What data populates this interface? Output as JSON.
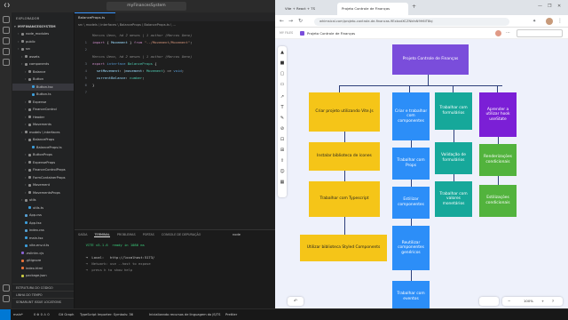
{
  "vscode": {
    "title": "myFinancesSystem",
    "menus": [
      "File",
      "Edit",
      "Selection",
      "View",
      "Go",
      "Run",
      "..."
    ],
    "explorer": {
      "header": "EXPLORADOR",
      "project": "MYFINANCESSYSTEM",
      "items": [
        {
          "label": "node_modules",
          "indent": 1,
          "kind": "folder",
          "color": "#8a8a8a"
        },
        {
          "label": "public",
          "indent": 1,
          "kind": "folder",
          "color": "#8a8a8a"
        },
        {
          "label": "src",
          "indent": 1,
          "kind": "folder",
          "color": "#8a8a8a"
        },
        {
          "label": "assets",
          "indent": 2,
          "kind": "folder",
          "color": "#8a8a8a"
        },
        {
          "label": "components",
          "indent": 2,
          "kind": "folder",
          "color": "#8a8a8a"
        },
        {
          "label": "Balance",
          "indent": 3,
          "kind": "folder",
          "color": "#8a8a8a"
        },
        {
          "label": "Button",
          "indent": 3,
          "kind": "folder",
          "color": "#8a8a8a"
        },
        {
          "label": "Button.tsx",
          "indent": 4,
          "kind": "file",
          "color": "#3c9dda",
          "selected": true
        },
        {
          "label": "Button.ts",
          "indent": 4,
          "kind": "file",
          "color": "#3c9dda"
        },
        {
          "label": "Expense",
          "indent": 3,
          "kind": "folder",
          "color": "#8a8a8a"
        },
        {
          "label": "FinanceControl",
          "indent": 3,
          "kind": "folder",
          "color": "#8a8a8a"
        },
        {
          "label": "Header",
          "indent": 3,
          "kind": "folder",
          "color": "#8a8a8a"
        },
        {
          "label": "Movements",
          "indent": 3,
          "kind": "folder",
          "color": "#8a8a8a"
        },
        {
          "label": "models \\ interfaces",
          "indent": 2,
          "kind": "folder",
          "color": "#8a8a8a"
        },
        {
          "label": "BalanceProps",
          "indent": 3,
          "kind": "folder",
          "color": "#8a8a8a"
        },
        {
          "label": "BalanceProps.ts",
          "indent": 4,
          "kind": "file",
          "color": "#3c9dda"
        },
        {
          "label": "ButtonProps",
          "indent": 3,
          "kind": "folder",
          "color": "#8a8a8a"
        },
        {
          "label": "ExpenseProps",
          "indent": 3,
          "kind": "folder",
          "color": "#8a8a8a"
        },
        {
          "label": "FinanceControlProps",
          "indent": 3,
          "kind": "folder",
          "color": "#8a8a8a"
        },
        {
          "label": "FormContainerProps",
          "indent": 3,
          "kind": "folder",
          "color": "#8a8a8a"
        },
        {
          "label": "Movement",
          "indent": 3,
          "kind": "folder",
          "color": "#8a8a8a"
        },
        {
          "label": "MovementsProps",
          "indent": 3,
          "kind": "folder",
          "color": "#8a8a8a"
        },
        {
          "label": "utils",
          "indent": 2,
          "kind": "folder",
          "color": "#8a8a8a"
        },
        {
          "label": "utils.ts",
          "indent": 3,
          "kind": "file",
          "color": "#3c9dda"
        },
        {
          "label": "App.css",
          "indent": 2,
          "kind": "file",
          "color": "#56a0d3"
        },
        {
          "label": "App.tsx",
          "indent": 2,
          "kind": "file",
          "color": "#3c9dda"
        },
        {
          "label": "index.css",
          "indent": 2,
          "kind": "file",
          "color": "#56a0d3"
        },
        {
          "label": "main.tsx",
          "indent": 2,
          "kind": "file",
          "color": "#3c9dda"
        },
        {
          "label": "vite-env.d.ts",
          "indent": 2,
          "kind": "file",
          "color": "#3c9dda"
        },
        {
          "label": ".eslintrc.cjs",
          "indent": 1,
          "kind": "file",
          "color": "#8a63d2"
        },
        {
          "label": ".gitignore",
          "indent": 1,
          "kind": "file",
          "color": "#e8733a"
        },
        {
          "label": "index.html",
          "indent": 1,
          "kind": "file",
          "color": "#e8733a"
        },
        {
          "label": "package.json",
          "indent": 1,
          "kind": "file",
          "color": "#cbcb41"
        }
      ],
      "bottom_sections": [
        "ESTRUTURA DO CÓDIGO",
        "LINHA DO TEMPO",
        "SONARLINT ISSUE LOCATIONS"
      ]
    },
    "tab": "BalanceProps.ts",
    "breadcrumb": "src \\ models \\ interfaces \\ BalanceProps \\ BalanceProps.ts \\ ...",
    "code": [
      {
        "n": "",
        "html": "<span class=\"cm\">Marcos Ueno, há 2 meses | 1 author (Marcos Ueno)</span>"
      },
      {
        "n": "1",
        "html": "<span class=\"kw\">import</span><span class=\"tx\"> { </span><span class=\"pr\">Movement</span><span class=\"tx\"> } </span><span class=\"kw\">from</span><span class=\"str\"> \"../Movement/Movement\"</span><span class=\"tx\">;</span>"
      },
      {
        "n": "2",
        "html": ""
      },
      {
        "n": "",
        "html": "<span class=\"cm\">Marcos Ueno, há 2 meses | 1 author (Marcos Ueno)</span>"
      },
      {
        "n": "3",
        "html": "<span class=\"kw\">export</span><span class=\"kw2\"> interface</span><span class=\"ty\"> BalanceProps</span><span class=\"tx\"> {</span>"
      },
      {
        "n": "4",
        "html": "<span class=\"tx\">  </span><span class=\"pr\">setMovement</span><span class=\"tx\">: (</span><span class=\"pr\">movement</span><span class=\"tx\">: </span><span class=\"ty\">Movement</span><span class=\"tx\">) =&gt; </span><span class=\"kw2\">void</span><span class=\"tx\">;</span>"
      },
      {
        "n": "5",
        "html": "<span class=\"tx\">  </span><span class=\"pr\">currentBalance</span><span class=\"tx\">: </span><span class=\"ty\">number</span><span class=\"tx\">;</span>"
      },
      {
        "n": "6",
        "html": "<span class=\"tx\">}</span>"
      },
      {
        "n": "7",
        "html": ""
      }
    ],
    "panel_tabs": [
      "SAÍDA",
      "TERMINAL",
      "PROBLEMAS",
      "PORTAS",
      "CONSOLE DE DEPURAÇÃO"
    ],
    "panel_active": "TERMINAL",
    "panel_right": "node",
    "terminal": [
      {
        "t": "  VITE v5.1.6  ready in 1086 ms",
        "c": "#3ad07c"
      },
      {
        "t": "",
        "c": "#ccc"
      },
      {
        "t": "  ➜  Local:   http://localhost:5173/",
        "c": "#cccccc"
      },
      {
        "t": "  ➜  Network: use --host to expose",
        "c": "#8b8b8b"
      },
      {
        "t": "  ➜  press h to show help",
        "c": "#8b8b8b"
      },
      {
        "t": "",
        "c": "#ccc"
      }
    ]
  },
  "status": {
    "left": [
      "main*",
      "0 ⊗ 0 ⚠ 0",
      "Git Graph",
      "TypeScript Importer: Symbols: 36",
      "Inicializando recursos de linguagem do JS/TS"
    ],
    "right": [
      "Ln 7, Col 1",
      "Espaços: 4",
      "UTF-8",
      "CRLF",
      "{} TypeScript",
      "Go Live",
      "Prettier"
    ]
  },
  "browser": {
    "tabs": [
      "Vite + React + TS",
      "Projeto Controle de Finanças"
    ],
    "active_tab": 1,
    "url": "whimsical.com/projeto-controle-de-financas-9ExbxdXCZNkfaN9H6iT8bj",
    "board_title": "Projeto Controle de Finanças",
    "workspace": "MY FILES",
    "zoom": "100%",
    "flow": {
      "root": "Projeto Controle de Finanças",
      "col1": [
        "Criar projeto utilizando Vite.Js",
        "Instalar biblioteca de ícones",
        "Trabalhar com Typescript",
        "Utilizar biblioteca Styled Components"
      ],
      "col2": [
        "Criar e trabalhar com componentes",
        "Trabalhar com Props",
        "Estilizar componentes",
        "Reutilizar componentes genéricos",
        "Trabalhar com eventos"
      ],
      "col3": [
        "Trabalhar com formulários",
        "Validação de formulários",
        "Trabalhar com valores monetários"
      ],
      "col4": [
        "Aprender a utilizar hook useState",
        "Renderizações condicionais",
        "Estilizações condicionais"
      ]
    }
  },
  "colors": {
    "yellow": "#f5c518",
    "blue": "#2c8ef8",
    "teal": "#16a89a",
    "purple": "#7b1fd6",
    "green": "#52b33d",
    "root": "#7a4ddb"
  }
}
